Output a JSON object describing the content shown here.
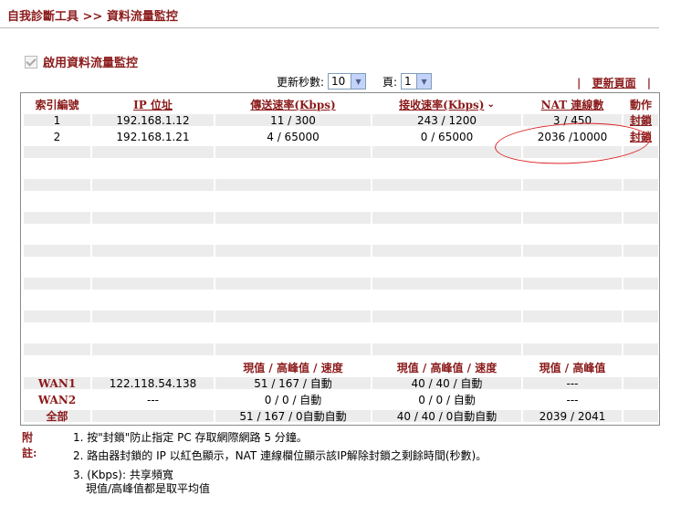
{
  "breadcrumb": "自我診斷工具 >> 資料流量監控",
  "enable": {
    "label": "啟用資料流量監控",
    "checked": true
  },
  "controls": {
    "refresh_label": "更新秒數:",
    "refresh_value": "10",
    "page_label": "頁:",
    "page_value": "1",
    "refresh_link": "更新頁面",
    "separator": "|"
  },
  "table": {
    "headers": [
      "索引編號",
      "IP 位址",
      "傳送速率(Kbps)",
      "接收速率(Kbps)",
      "NAT 連線數",
      "動作"
    ],
    "sort_mark": "⌄",
    "rows": [
      {
        "index": "1",
        "ip": "192.168.1.12",
        "tx": "11 / 300",
        "rx": "243 / 1200",
        "nat": "3 / 450",
        "action": "封鎖"
      },
      {
        "index": "2",
        "ip": "192.168.1.21",
        "tx": "4 / 65000",
        "rx": "0 / 65000",
        "nat": "2036 /10000",
        "action": "封鎖"
      }
    ]
  },
  "summary": {
    "headers": {
      "tx": "現值 / 高峰值 / 速度",
      "rx": "現值 / 高峰值 / 速度",
      "nat": "現值 / 高峰值"
    },
    "rows": [
      {
        "label": "WAN1",
        "ip": "122.118.54.138",
        "tx": "51 / 167 / 自動",
        "rx": "40 / 40 / 自動",
        "nat": "---"
      },
      {
        "label": "WAN2",
        "ip": "---",
        "tx": "0 / 0 / 自動",
        "rx": "0 / 0 / 自動",
        "nat": "---"
      },
      {
        "label": "全部",
        "ip": "",
        "tx": "51 / 167 / 0自動自動",
        "rx": "40 / 40 / 0自動自動",
        "nat": "2039 / 2041"
      }
    ]
  },
  "notes": {
    "title": "附註:",
    "items": [
      "1. 按\"封鎖\"防止指定 PC 存取網際網路 5 分鐘。",
      "2. 路由器封鎖的 IP 以紅色顯示，NAT 連線欄位顯示該IP解除封鎖之剩餘時間(秒數)。",
      "3. (Kbps): 共享頻寬",
      "現值/高峰值都是取平均值"
    ]
  }
}
